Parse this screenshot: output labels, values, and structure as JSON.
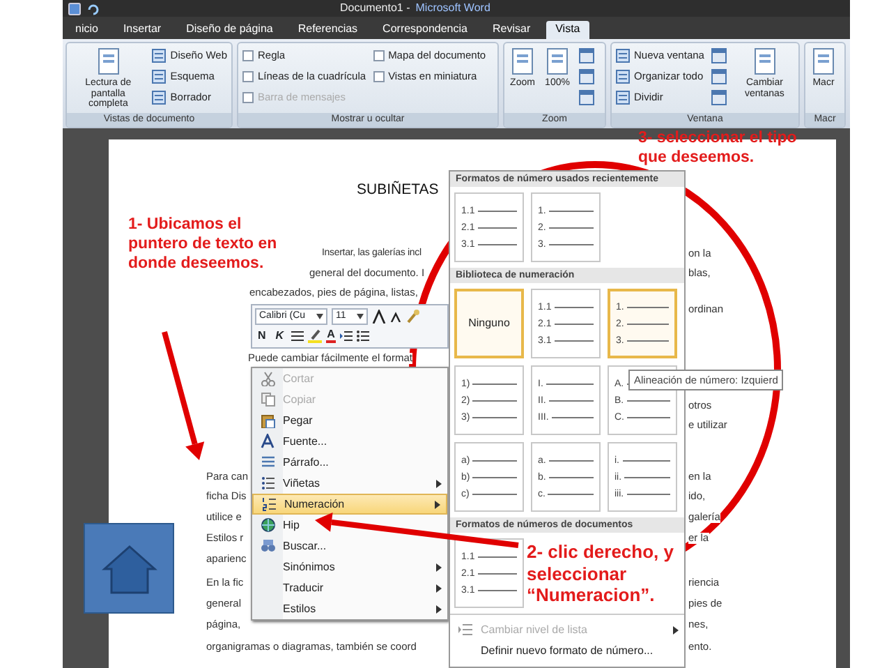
{
  "window": {
    "title_document": "Documento1 -",
    "title_app": "Microsoft Word"
  },
  "tabs": [
    {
      "label": "nicio",
      "selected": false
    },
    {
      "label": "Insertar",
      "selected": false
    },
    {
      "label": "Diseño de página",
      "selected": false
    },
    {
      "label": "Referencias",
      "selected": false
    },
    {
      "label": "Correspondencia",
      "selected": false
    },
    {
      "label": "Revisar",
      "selected": false
    },
    {
      "label": "Vista",
      "selected": true
    }
  ],
  "ribbon_groups": [
    {
      "label": "Vistas de documento",
      "items": [
        {
          "kind": "large",
          "label": "Lectura de pantalla completa"
        },
        {
          "kind": "small",
          "label": "Diseño Web"
        },
        {
          "kind": "small",
          "label": "Esquema"
        },
        {
          "kind": "small",
          "label": "Borrador"
        }
      ]
    },
    {
      "label": "Mostrar u ocultar",
      "items": [
        {
          "kind": "check",
          "label": "Regla",
          "checked": false,
          "disabled": false
        },
        {
          "kind": "check",
          "label": "Líneas de la cuadrícula",
          "checked": false,
          "disabled": false
        },
        {
          "kind": "check",
          "label": "Barra de mensajes",
          "checked": false,
          "disabled": true
        },
        {
          "kind": "check",
          "label": "Mapa del documento",
          "checked": false,
          "disabled": false
        },
        {
          "kind": "check",
          "label": "Vistas en miniatura",
          "checked": false,
          "disabled": false
        }
      ]
    },
    {
      "label": "Zoom",
      "items": [
        {
          "kind": "large",
          "label": "Zoom"
        },
        {
          "kind": "large",
          "label": "100%"
        },
        {
          "kind": "icon"
        },
        {
          "kind": "icon"
        },
        {
          "kind": "icon"
        }
      ]
    },
    {
      "label": "Ventana",
      "items": [
        {
          "kind": "small",
          "label": "Nueva ventana"
        },
        {
          "kind": "small",
          "label": "Organizar todo"
        },
        {
          "kind": "small",
          "label": "Dividir"
        },
        {
          "kind": "icon"
        },
        {
          "kind": "icon"
        },
        {
          "kind": "icon"
        },
        {
          "kind": "large",
          "label": "Cambiar ventanas"
        }
      ]
    },
    {
      "label": "Macr",
      "items": [
        {
          "kind": "large",
          "label": "Macr"
        }
      ]
    }
  ],
  "document": {
    "heading": "SUBIÑETAS",
    "lines_left": [
      "Insertar, las galerías incl",
      "general del documento. I",
      "encabezados, pies de página, listas,",
      "Puede cambiar fácilmente el format",
      "Para can",
      "ficha Dis",
      "utilice e",
      "Estilos r",
      "aparienc",
      "En la fic",
      "general",
      "página,",
      "organigramas o diagramas, también se coord"
    ],
    "lines_right": [
      "on la",
      "blas,",
      "ordinan",
      "otros",
      "e utilizar",
      "en la",
      "ido,",
      "galería",
      "er la",
      "riencia",
      "pies de",
      "nes,",
      "ento."
    ]
  },
  "mini_toolbar": {
    "font": "Calibri (Cu",
    "size": "11",
    "bold_key": "N",
    "italic_key": "K",
    "color_key": "A"
  },
  "context_menu": [
    {
      "label": "Cortar",
      "disabled": true,
      "submenu": false,
      "selected": false
    },
    {
      "label": "Copiar",
      "disabled": true,
      "submenu": false,
      "selected": false
    },
    {
      "label": "Pegar",
      "disabled": false,
      "submenu": false,
      "selected": false
    },
    {
      "label": "Fuente...",
      "disabled": false,
      "submenu": false,
      "selected": false
    },
    {
      "label": "Párrafo...",
      "disabled": false,
      "submenu": false,
      "selected": false
    },
    {
      "label": "Viñetas",
      "disabled": false,
      "submenu": true,
      "selected": false
    },
    {
      "label": "Numeración",
      "disabled": false,
      "submenu": true,
      "selected": true
    },
    {
      "label": "Hip",
      "disabled": false,
      "submenu": false,
      "selected": false
    },
    {
      "label": "Buscar...",
      "disabled": false,
      "submenu": false,
      "selected": false
    },
    {
      "label": "Sinónimos",
      "disabled": false,
      "submenu": true,
      "selected": false
    },
    {
      "label": "Traducir",
      "disabled": false,
      "submenu": true,
      "selected": false
    },
    {
      "label": "Estilos",
      "disabled": false,
      "submenu": true,
      "selected": false
    }
  ],
  "numbering_gallery": {
    "sections": [
      {
        "title": "Formatos de número usados recientemente",
        "tiles": [
          {
            "kind": "list",
            "lines": [
              "1.1",
              "2.1",
              "3.1"
            ],
            "selected": false
          },
          {
            "kind": "list",
            "lines": [
              "1.",
              "2.",
              "3."
            ],
            "selected": false
          }
        ]
      },
      {
        "title": "Biblioteca de numeración",
        "tiles": [
          {
            "kind": "none",
            "label": "Ninguno",
            "selected": true
          },
          {
            "kind": "list",
            "lines": [
              "1.1",
              "2.1",
              "3.1"
            ],
            "selected": false
          },
          {
            "kind": "list",
            "lines": [
              "1.",
              "2.",
              "3."
            ],
            "selected": true
          },
          {
            "kind": "list",
            "lines": [
              "1)",
              "2)",
              "3)"
            ],
            "selected": false
          },
          {
            "kind": "list",
            "lines": [
              "I.",
              "II.",
              "III."
            ],
            "selected": false
          },
          {
            "kind": "list",
            "lines": [
              "A.",
              "B.",
              "C."
            ],
            "selected": false
          },
          {
            "kind": "list",
            "lines": [
              "a)",
              "b)",
              "c)"
            ],
            "selected": false
          },
          {
            "kind": "list",
            "lines": [
              "a.",
              "b.",
              "c."
            ],
            "selected": false
          },
          {
            "kind": "list",
            "lines": [
              "i.",
              "ii.",
              "iii."
            ],
            "selected": false
          }
        ]
      },
      {
        "title": "Formatos de números de documentos",
        "tiles": [
          {
            "kind": "list",
            "lines": [
              "1.1",
              "2.1",
              "3.1"
            ],
            "selected": false
          }
        ]
      }
    ],
    "footer": [
      {
        "label": "Cambiar nivel de lista",
        "disabled": true,
        "submenu": true
      },
      {
        "label": "Definir nuevo formato de número...",
        "disabled": false,
        "submenu": false
      }
    ]
  },
  "tooltip": "Alineación de número: Izquierd",
  "annotations": [
    {
      "lines": [
        "1- Ubicamos el",
        "puntero de texto en",
        "donde deseemos."
      ]
    },
    {
      "lines": [
        "3- seleccionar el tipo",
        "que deseemos."
      ]
    },
    {
      "lines": [
        "2- clic derecho, y",
        "seleccionar",
        "“Numeracion”."
      ]
    }
  ]
}
